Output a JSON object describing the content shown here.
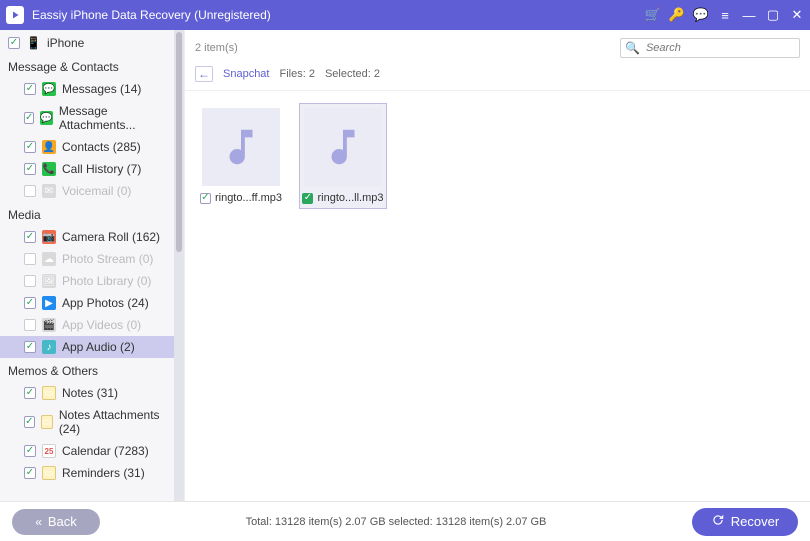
{
  "titlebar": {
    "app_name": "Eassiy iPhone Data Recovery (Unregistered)"
  },
  "sidebar": {
    "device": "iPhone",
    "groups": [
      {
        "title": "Message & Contacts",
        "items": [
          {
            "label": "Messages (14)",
            "checked": true,
            "icon": "messages",
            "iconClass": "i-green"
          },
          {
            "label": "Message Attachments...",
            "checked": true,
            "icon": "attach",
            "iconClass": "i-green"
          },
          {
            "label": "Contacts (285)",
            "checked": true,
            "icon": "contacts",
            "iconClass": "i-orange"
          },
          {
            "label": "Call History (7)",
            "checked": true,
            "icon": "call",
            "iconClass": "i-green"
          },
          {
            "label": "Voicemail (0)",
            "checked": false,
            "disabled": true,
            "icon": "voicemail",
            "iconClass": "i-gray"
          }
        ]
      },
      {
        "title": "Media",
        "items": [
          {
            "label": "Camera Roll (162)",
            "checked": true,
            "icon": "camera",
            "iconClass": "i-redish"
          },
          {
            "label": "Photo Stream (0)",
            "checked": false,
            "disabled": true,
            "icon": "stream",
            "iconClass": "i-gray"
          },
          {
            "label": "Photo Library (0)",
            "checked": false,
            "disabled": true,
            "icon": "library",
            "iconClass": "i-gray"
          },
          {
            "label": "App Photos (24)",
            "checked": true,
            "icon": "appphotos",
            "iconClass": "i-blue"
          },
          {
            "label": "App Videos (0)",
            "checked": false,
            "disabled": true,
            "icon": "videos",
            "iconClass": "i-gray"
          },
          {
            "label": "App Audio (2)",
            "checked": true,
            "selected": true,
            "icon": "audio",
            "iconClass": "i-teal"
          }
        ]
      },
      {
        "title": "Memos & Others",
        "items": [
          {
            "label": "Notes (31)",
            "checked": true,
            "icon": "notes",
            "iconClass": "i-note"
          },
          {
            "label": "Notes Attachments (24)",
            "checked": true,
            "icon": "notesatt",
            "iconClass": "i-note"
          },
          {
            "label": "Calendar (7283)",
            "checked": true,
            "icon": "calendar",
            "iconClass": "i-cal"
          },
          {
            "label": "Reminders (31)",
            "checked": true,
            "icon": "reminders",
            "iconClass": "i-note"
          }
        ]
      }
    ]
  },
  "content": {
    "count": "2 item(s)",
    "search_placeholder": "Search",
    "breadcrumb": {
      "folder": "Snapchat",
      "files": "Files: 2",
      "selected": "Selected: 2"
    },
    "tiles": [
      {
        "name": "ringto...ff.mp3",
        "checked": true,
        "selected": false
      },
      {
        "name": "ringto...ll.mp3",
        "checked": true,
        "selected": true
      }
    ]
  },
  "footer": {
    "back": "Back",
    "recover": "Recover",
    "stats": "Total: 13128 item(s) 2.07 GB    selected: 13128 item(s) 2.07 GB"
  }
}
